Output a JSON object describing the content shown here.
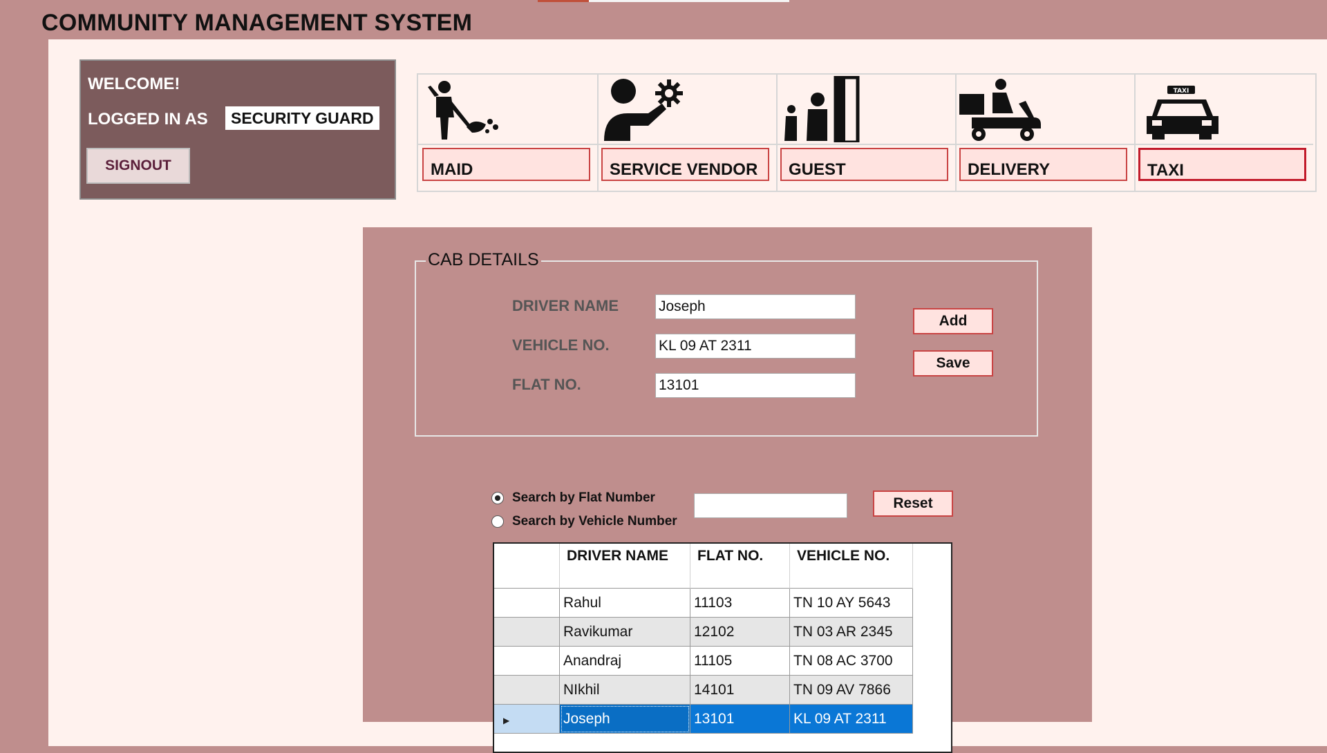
{
  "app": {
    "title": "COMMUNITY MANAGEMENT SYSTEM"
  },
  "welcome": {
    "greeting": "WELCOME!",
    "logged_in_label": "LOGGED IN AS",
    "role": "SECURITY GUARD",
    "signout_label": "SIGNOUT"
  },
  "categories": [
    {
      "label": "MAID",
      "icon": "maid-icon"
    },
    {
      "label": "SERVICE VENDOR",
      "icon": "service-vendor-icon"
    },
    {
      "label": "GUEST",
      "icon": "guest-icon"
    },
    {
      "label": "DELIVERY",
      "icon": "delivery-icon"
    },
    {
      "label": "TAXI",
      "icon": "taxi-icon",
      "active": true
    }
  ],
  "cab_details": {
    "legend": "CAB DETAILS",
    "driver_name_label": "DRIVER NAME",
    "driver_name_value": "Joseph",
    "vehicle_no_label": "VEHICLE NO.",
    "vehicle_no_value": "KL 09 AT 2311",
    "flat_no_label": "FLAT NO.",
    "flat_no_value": "13101",
    "add_label": "Add",
    "save_label": "Save"
  },
  "search": {
    "by_flat_label": "Search by Flat Number",
    "by_vehicle_label": "Search by Vehicle Number",
    "selected": "flat",
    "value": "",
    "reset_label": "Reset"
  },
  "grid": {
    "columns": [
      "DRIVER NAME",
      "FLAT NO.",
      "VEHICLE NO."
    ],
    "rows": [
      {
        "driver": "Rahul",
        "flat": "11103",
        "vehicle": "TN 10 AY 5643"
      },
      {
        "driver": "Ravikumar",
        "flat": "12102",
        "vehicle": "TN 03 AR 2345"
      },
      {
        "driver": "Anandraj",
        "flat": "11105",
        "vehicle": "TN 08 AC 3700"
      },
      {
        "driver": "NIkhil",
        "flat": "14101",
        "vehicle": "TN 09 AV 7866"
      },
      {
        "driver": "Joseph",
        "flat": "13101",
        "vehicle": "KL 09 AT 2311",
        "selected": true
      }
    ]
  },
  "colors": {
    "background": "#bf8e8d",
    "content": "#fff2ee",
    "welcome_panel": "#7c5b5c",
    "button_fill": "#ffe3e0",
    "button_border": "#c94343",
    "selection": "#0a77d6"
  }
}
